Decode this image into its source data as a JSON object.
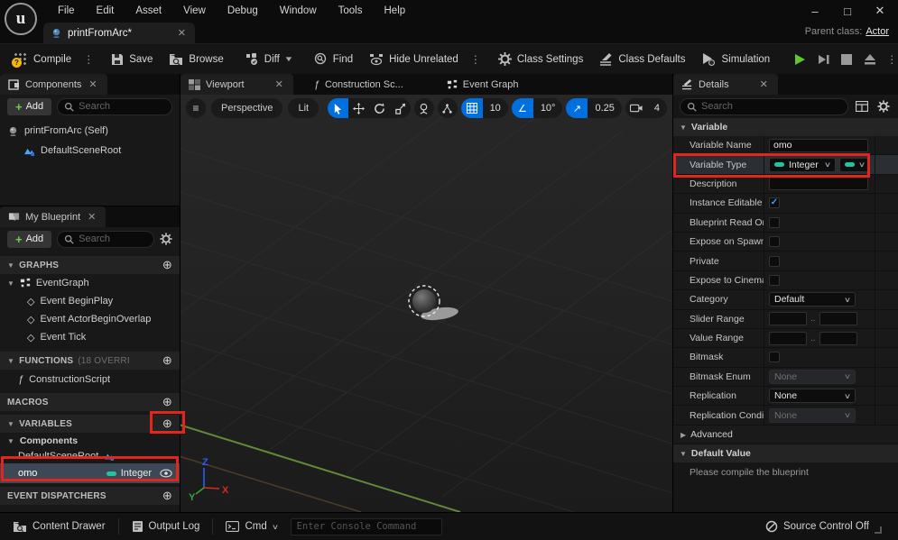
{
  "colors": {
    "accent_blue": "#0070e0",
    "integer_teal": "#26c1a1",
    "annotation_red": "#e3261d",
    "play_green": "#61c52e"
  },
  "window": {
    "menus": [
      "File",
      "Edit",
      "Asset",
      "View",
      "Debug",
      "Window",
      "Tools",
      "Help"
    ],
    "asset_tab": "printFromArc*",
    "parent_class_label": "Parent class:",
    "parent_class_value": "Actor"
  },
  "toolbar": {
    "compile": "Compile",
    "save": "Save",
    "browse": "Browse",
    "diff": "Diff",
    "find": "Find",
    "hide_unrelated": "Hide Unrelated",
    "class_settings": "Class Settings",
    "class_defaults": "Class Defaults",
    "simulation": "Simulation"
  },
  "components_panel": {
    "tab": "Components",
    "add": "Add",
    "search_placeholder": "Search",
    "root_item": "printFromArc (Self)",
    "child_item": "DefaultSceneRoot"
  },
  "my_blueprint": {
    "tab": "My Blueprint",
    "add": "Add",
    "search_placeholder": "Search",
    "graphs_label": "GRAPHS",
    "eventgraph": "EventGraph",
    "events": [
      "Event BeginPlay",
      "Event ActorBeginOverlap",
      "Event Tick"
    ],
    "functions_label": "FUNCTIONS",
    "functions_suffix": "(18 OVERRI",
    "construction_script": "ConstructionScript",
    "macros_label": "MACROS",
    "variables_label": "VARIABLES",
    "components_group": "Components",
    "default_scene_root": "DefaultSceneRoot",
    "variable_name": "omo",
    "variable_type": "Integer",
    "event_dispatchers_label": "EVENT DISPATCHERS"
  },
  "viewport": {
    "tabs": [
      "Viewport",
      "Construction Sc...",
      "Event Graph"
    ],
    "perspective": "Perspective",
    "lit": "Lit",
    "grid_snap": "10",
    "angle_snap": "10°",
    "scale_snap": "0.25",
    "camera_speed": "4",
    "gizmo": {
      "x": "X",
      "y": "Y",
      "z": "Z"
    }
  },
  "details": {
    "tab": "Details",
    "search_placeholder": "Search",
    "section_variable": "Variable",
    "range_separator": "..",
    "rows": [
      {
        "label": "Variable Name",
        "value": "omo"
      },
      {
        "label": "Variable Type",
        "value": "Integer"
      },
      {
        "label": "Description",
        "value": ""
      },
      {
        "label": "Instance Editable",
        "checked": true
      },
      {
        "label": "Blueprint Read Only",
        "checked": false
      },
      {
        "label": "Expose on Spawn",
        "checked": false
      },
      {
        "label": "Private",
        "checked": false
      },
      {
        "label": "Expose to Cinemati",
        "checked": false
      },
      {
        "label": "Category",
        "value": "Default"
      },
      {
        "label": "Slider Range"
      },
      {
        "label": "Value Range"
      },
      {
        "label": "Bitmask",
        "checked": false
      },
      {
        "label": "Bitmask Enum",
        "value": "None"
      },
      {
        "label": "Replication",
        "value": "None"
      },
      {
        "label": "Replication Conditi",
        "value": "None"
      }
    ],
    "advanced_label": "Advanced",
    "default_value_label": "Default Value",
    "compile_note": "Please compile the blueprint"
  },
  "status_bar": {
    "content_drawer": "Content Drawer",
    "output_log": "Output Log",
    "cmd": "Cmd",
    "console_placeholder": "Enter Console Command",
    "source_control": "Source Control Off"
  }
}
